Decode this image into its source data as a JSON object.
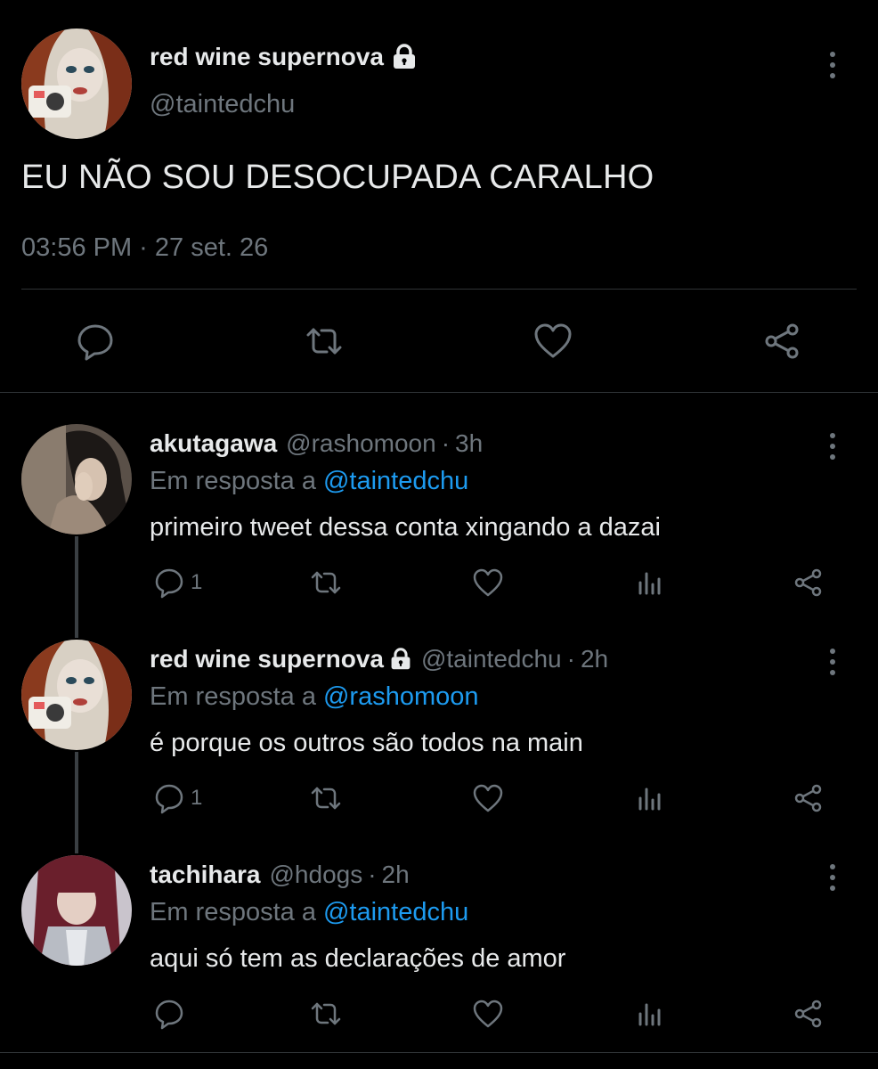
{
  "main_tweet": {
    "display_name": "red wine supernova",
    "handle": "@taintedchu",
    "text": "EU NÃO SOU DESOCUPADA CARALHO",
    "timestamp": "03:56 PM · 27 set. 26",
    "actions": [
      "reply-icon",
      "retweet-icon",
      "like-icon",
      "share-icon"
    ]
  },
  "replies": [
    {
      "display_name": "akutagawa",
      "handle": "@rashomoon",
      "separator": "·",
      "time": "3h",
      "reply_prefix": "Em resposta a",
      "reply_to": "@taintedchu",
      "text": "primeiro tweet dessa conta xingando a dazai",
      "reply_count": "1",
      "locked": false
    },
    {
      "display_name": "red wine supernova",
      "handle": "@taintedchu",
      "separator": "·",
      "time": "2h",
      "reply_prefix": "Em resposta a",
      "reply_to": "@rashomoon",
      "text": "é porque os outros são todos na main",
      "reply_count": "1",
      "locked": true
    },
    {
      "display_name": "tachihara",
      "handle": "@hdogs",
      "separator": "·",
      "time": "2h",
      "reply_prefix": "Em resposta a",
      "reply_to": "@taintedchu",
      "text": "aqui só tem as declarações de amor",
      "reply_count": "",
      "locked": false
    }
  ],
  "colors": {
    "background": "#000000",
    "text": "#e7e9ea",
    "muted": "#6e767d",
    "link": "#1d9bf0",
    "divider": "#2f3336"
  }
}
